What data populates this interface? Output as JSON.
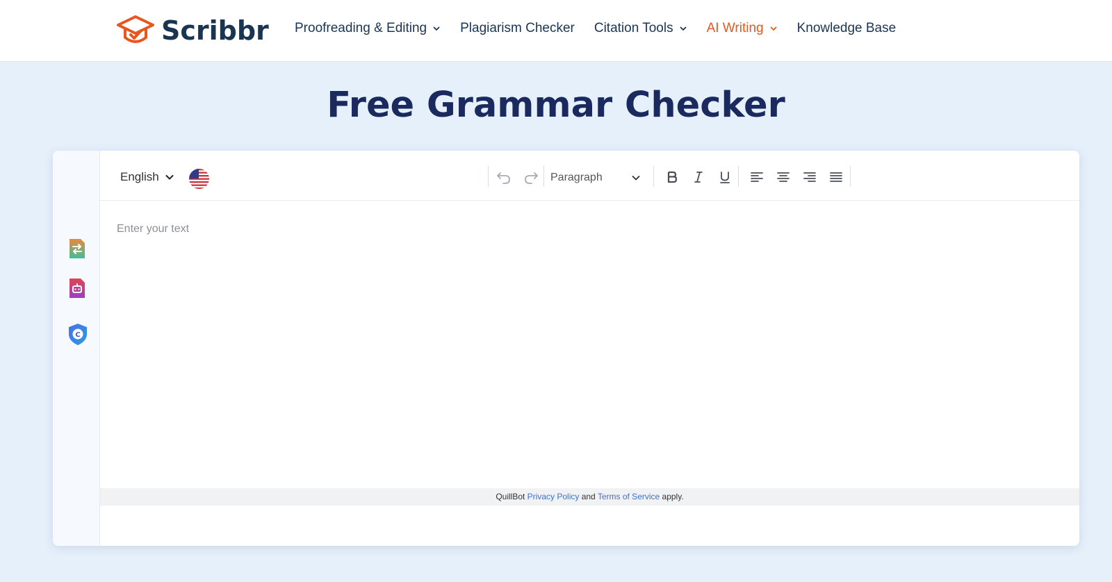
{
  "header": {
    "logo_text": "Scribbr",
    "nav": [
      {
        "label": "Proofreading & Editing",
        "has_dropdown": true,
        "active": false
      },
      {
        "label": "Plagiarism Checker",
        "has_dropdown": false,
        "active": false
      },
      {
        "label": "Citation Tools",
        "has_dropdown": true,
        "active": false
      },
      {
        "label": "AI Writing",
        "has_dropdown": true,
        "active": true
      },
      {
        "label": "Knowledge Base",
        "has_dropdown": false,
        "active": false
      }
    ]
  },
  "page": {
    "title": "Free Grammar Checker"
  },
  "side_rail": {
    "icons": [
      "paraphraser-icon",
      "ai-detector-icon",
      "citation-shield-icon"
    ]
  },
  "editor": {
    "language": "English",
    "paragraph_style": "Paragraph",
    "placeholder": "Enter your text",
    "toolbar_icons": [
      "undo-icon",
      "redo-icon",
      "bold-icon",
      "italic-icon",
      "underline-icon",
      "align-left-icon",
      "align-center-icon",
      "align-right-icon",
      "align-justify-icon"
    ],
    "legal": {
      "prefix": "QuillBot ",
      "privacy_label": "Privacy Policy",
      "middle": " and ",
      "terms_label": "Terms of Service",
      "suffix": " apply."
    }
  },
  "colors": {
    "brand_orange": "#e8561e",
    "title_navy": "#1b2a5e",
    "page_bg": "#e6f0fb",
    "link_blue": "#3d6fd6"
  }
}
